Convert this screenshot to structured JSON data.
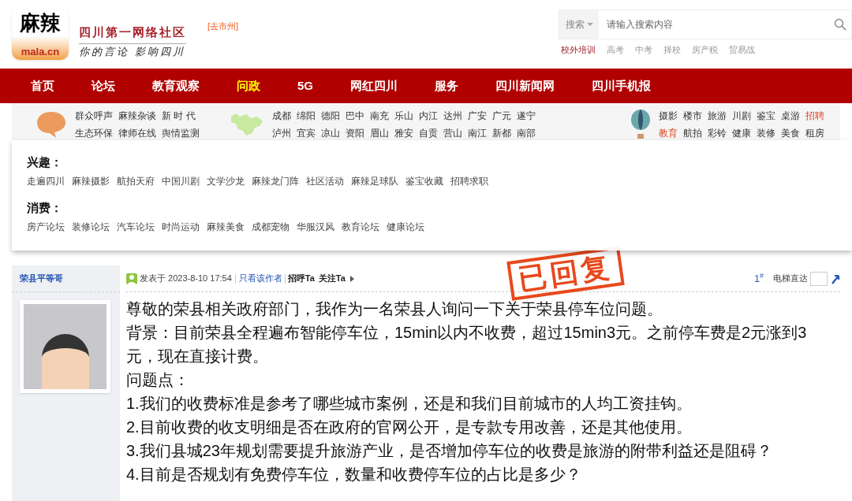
{
  "header": {
    "logo_text": "麻辣",
    "logo_domain": "mala.cn",
    "site_name": "四川第一网络社区",
    "slogan": "你的言论 影响四川",
    "city_link": "[去市州]"
  },
  "search": {
    "scope": "搜索",
    "placeholder": "请输入搜索内容",
    "hot_words": [
      {
        "label": "校外培训",
        "highlight": true
      },
      {
        "label": "高考",
        "highlight": false
      },
      {
        "label": "中考",
        "highlight": false
      },
      {
        "label": "择校",
        "highlight": false
      },
      {
        "label": "房产税",
        "highlight": false
      },
      {
        "label": "贸易战",
        "highlight": false
      }
    ]
  },
  "nav": [
    {
      "label": "首页",
      "selected": false
    },
    {
      "label": "论坛",
      "selected": false
    },
    {
      "label": "教育观察",
      "selected": false
    },
    {
      "label": "问政",
      "selected": true
    },
    {
      "label": "5G",
      "selected": false
    },
    {
      "label": "网红四川",
      "selected": false
    },
    {
      "label": "服务",
      "selected": false
    },
    {
      "label": "四川新闻网",
      "selected": false
    },
    {
      "label": "四川手机报",
      "selected": false
    }
  ],
  "subnav": [
    {
      "kind": "speech",
      "rows": [
        [
          {
            "label": "群众呼声",
            "highlight": false
          },
          {
            "label": "麻辣杂谈",
            "highlight": false
          },
          {
            "label": "新 时 代",
            "highlight": false
          }
        ],
        [
          {
            "label": "生态环保",
            "highlight": false
          },
          {
            "label": "律师在线",
            "highlight": false
          },
          {
            "label": "舆情监测",
            "highlight": false
          }
        ]
      ]
    },
    {
      "kind": "map",
      "rows": [
        [
          {
            "label": "成都",
            "highlight": false
          },
          {
            "label": "绵阳",
            "highlight": false
          },
          {
            "label": "德阳",
            "highlight": false
          },
          {
            "label": "巴中",
            "highlight": false
          },
          {
            "label": "南充",
            "highlight": false
          },
          {
            "label": "乐山",
            "highlight": false
          },
          {
            "label": "内江",
            "highlight": false
          },
          {
            "label": "达州",
            "highlight": false
          },
          {
            "label": "广安",
            "highlight": false
          },
          {
            "label": "广元",
            "highlight": false
          },
          {
            "label": "遂宁",
            "highlight": false
          }
        ],
        [
          {
            "label": "泸州",
            "highlight": false
          },
          {
            "label": "宜宾",
            "highlight": false
          },
          {
            "label": "凉山",
            "highlight": false
          },
          {
            "label": "资阳",
            "highlight": false
          },
          {
            "label": "眉山",
            "highlight": false
          },
          {
            "label": "雅安",
            "highlight": false
          },
          {
            "label": "自贡",
            "highlight": false
          },
          {
            "label": "营山",
            "highlight": false
          },
          {
            "label": "南江",
            "highlight": false
          },
          {
            "label": "新都",
            "highlight": false
          },
          {
            "label": "南部",
            "highlight": false
          }
        ]
      ]
    },
    {
      "kind": "balloon",
      "rows": [
        [
          {
            "label": "摄影",
            "highlight": false
          },
          {
            "label": "楼市",
            "highlight": false
          },
          {
            "label": "旅游",
            "highlight": false
          },
          {
            "label": "川剧",
            "highlight": false
          },
          {
            "label": "鉴宝",
            "highlight": false
          },
          {
            "label": "桌游",
            "highlight": false
          },
          {
            "label": "招聘",
            "highlight": true
          }
        ],
        [
          {
            "label": "教育",
            "highlight": true
          },
          {
            "label": "航拍",
            "highlight": false
          },
          {
            "label": "彩铃",
            "highlight": false
          },
          {
            "label": "健康",
            "highlight": false
          },
          {
            "label": "装修",
            "highlight": false
          },
          {
            "label": "美食",
            "highlight": false
          },
          {
            "label": "租房",
            "highlight": false
          }
        ]
      ]
    }
  ],
  "dropdown": {
    "sections": [
      {
        "title": "兴趣：",
        "links": [
          "走遍四川",
          "麻辣摄影",
          "航拍天府",
          "中国川剧",
          "文学沙龙",
          "麻辣龙门阵",
          "社区活动",
          "麻辣足球队",
          "鉴宝收藏",
          "招聘求职"
        ]
      },
      {
        "title": "消费：",
        "links": [
          "房产论坛",
          "装修论坛",
          "汽车论坛",
          "时尚运动",
          "麻辣美食",
          "成都宠物",
          "华服汉风",
          "教育论坛",
          "健康论坛"
        ]
      }
    ]
  },
  "post": {
    "author": "荣县平等哥",
    "posted": "发表于 2023-8-10 17:54",
    "author_only": "只看该作者",
    "greet": "招呼Ta",
    "follow": "关注Ta",
    "floor": "1",
    "floor_mark": "#",
    "jump_label": "电梯直达",
    "stamp": "已回复",
    "body": [
      "尊敬的荣县相关政府部门，我作为一名荣县人询问一下关于荣县停车位问题。",
      "背景：目前荣县全程遍布智能停车位，15min以内不收费，超过15min3元。之前停车费是2元涨到3元，现在直接计费。",
      "问题点：",
      "1.我们的收费标准是参考了哪些城市案例，还是和我们目前城市的人均工资挂钩。",
      "2.目前收费的收支明细是否在政府的官网公开，是专款专用改善，还是其他使用。",
      "3.我们县城23年规划需要提升旅游产业，是否增加停车位的收费是旅游的附带利益还是阻碍？",
      "4.目前是否规划有免费停车位，数量和收费停车位的占比是多少？"
    ]
  }
}
